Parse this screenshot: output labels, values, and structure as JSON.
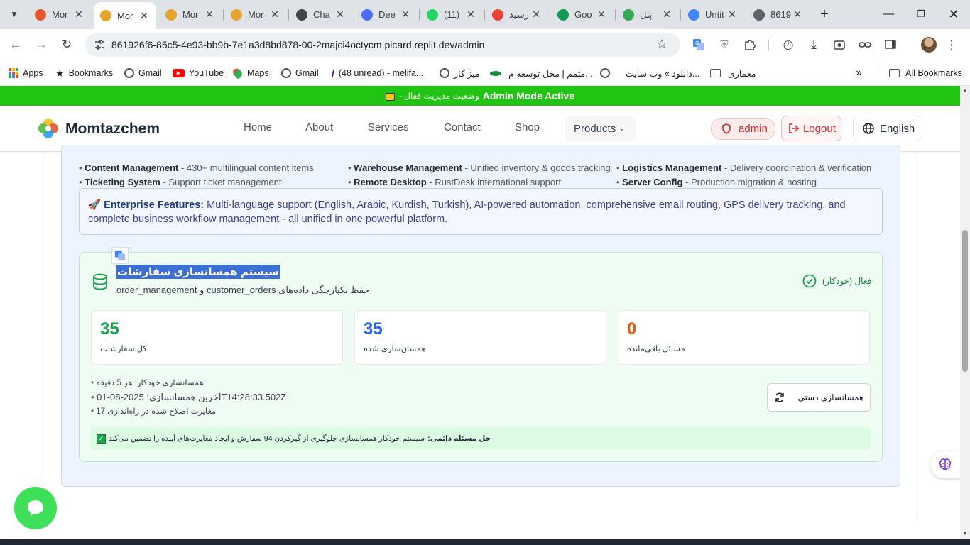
{
  "browser": {
    "tabs": [
      {
        "title": "Mor",
        "favicon": "momtaz-logo",
        "color": "#e4572e"
      },
      {
        "title": "Mor",
        "favicon": "momtaz-logo",
        "color": "#e4a52e",
        "active": true
      },
      {
        "title": "Mor",
        "favicon": "momtaz-logo",
        "color": "#e4a52e"
      },
      {
        "title": "Mor",
        "favicon": "momtaz-logo",
        "color": "#e4a52e"
      },
      {
        "title": "Cha",
        "favicon": "chatgpt-icon",
        "color": "#444444"
      },
      {
        "title": "Dee",
        "favicon": "deepseek-icon",
        "color": "#4d6bfe"
      },
      {
        "title": "(11)",
        "favicon": "whatsapp-icon",
        "color": "#25d366"
      },
      {
        "title": "رسید",
        "favicon": "gmail-icon",
        "color": "#ea4335"
      },
      {
        "title": "Goo",
        "favicon": "sheets-icon",
        "color": "#0f9d58"
      },
      {
        "title": "پنل",
        "favicon": "shield-icon",
        "color": "#34a853"
      },
      {
        "title": "Untit",
        "favicon": "docs-icon",
        "color": "#4285f4"
      },
      {
        "title": "8619",
        "favicon": "globe-icon",
        "color": "#5f6368"
      }
    ],
    "url": "861926f6-85c5-4e93-bb9b-7e1a3d8bd878-00-2majci4octycm.picard.replit.dev/admin",
    "bookmarks": [
      {
        "label": "Apps",
        "icon": "apps-grid-icon"
      },
      {
        "label": "Bookmarks",
        "icon": "star-icon"
      },
      {
        "label": "Gmail",
        "icon": "globe-icon"
      },
      {
        "label": "YouTube",
        "icon": "youtube-icon"
      },
      {
        "label": "Maps",
        "icon": "maps-icon"
      },
      {
        "label": "Gmail",
        "icon": "globe-icon"
      },
      {
        "label": "(48 unread) - melifa...",
        "icon": "yahoo-icon"
      },
      {
        "label": "میز کار",
        "icon": "globe-icon"
      },
      {
        "label": "متمم | محل توسعه م...",
        "icon": "motamem-icon"
      },
      {
        "label": "دانلود » وب سایت...",
        "icon": "globe-icon"
      },
      {
        "label": "معماری",
        "icon": "folder-icon"
      }
    ],
    "all_bookmarks": "All Bookmarks"
  },
  "banner": {
    "text_fa": "وضعیت مدیریت فعال -",
    "text_en": "Admin Mode Active"
  },
  "nav": {
    "brand": "Momtazchem",
    "links": [
      "Home",
      "About",
      "Services",
      "Contact",
      "Shop"
    ],
    "products": "Products",
    "admin": "admin",
    "logout": "Logout",
    "language": "English"
  },
  "features": {
    "col1": [
      {
        "name": "Content Management",
        "desc": " - 430+ multilingual content items"
      },
      {
        "name": "Ticketing System",
        "desc": " - Support ticket management"
      }
    ],
    "col2": [
      {
        "name": "Warehouse Management",
        "desc": " - Unified inventory & goods tracking"
      },
      {
        "name": "Remote Desktop",
        "desc": " - RustDesk international support"
      }
    ],
    "col3": [
      {
        "name": "Logistics Management",
        "desc": " - Delivery coordination & verification"
      },
      {
        "name": "Server Config",
        "desc": " - Production migration & hosting"
      }
    ]
  },
  "enterprise": {
    "title": "Enterprise Features:",
    "text": "Multi-language support (English, Arabic, Kurdish, Turkish), AI-powered automation, comprehensive email routing, GPS delivery tracking, and complete business workflow management - all unified in one powerful platform."
  },
  "sync": {
    "title": "سیستم همسانسازی سفارشات",
    "subtitle": "حفظ یکپارچگی داده‌های customer_orders و order_management",
    "status": "فعال (خودکار)",
    "stats": [
      {
        "value": "35",
        "label": "کل سفارشات",
        "color": "#16a34a"
      },
      {
        "value": "35",
        "label": "همسان‌سازی شده",
        "color": "#2563eb"
      },
      {
        "value": "0",
        "label": "مسائل باقی‌مانده",
        "color": "#ea580c"
      }
    ],
    "details": [
      "همسانسازی خودکار: هر 5 دقیقه",
      "آخرین همسانسازی: 2025-08-01T14:28:33.502Z",
      "مغایرت اصلاح شده در راه‌اندازی 17"
    ],
    "manual_button": "همسانسازی دستی",
    "permanent_title": "حل مسئله دائمی:",
    "permanent_text": "سیستم خودکار همسانسازی جلوگیری از گیرکردن 94 سفارش و ایجاد مغایرت‌های آینده را تضمین می‌کند"
  },
  "colors": {
    "banner": "#22c414",
    "accent_green": "#16a34a",
    "accent_blue": "#2563eb",
    "accent_orange": "#ea580c",
    "admin_red": "#dc2626"
  }
}
